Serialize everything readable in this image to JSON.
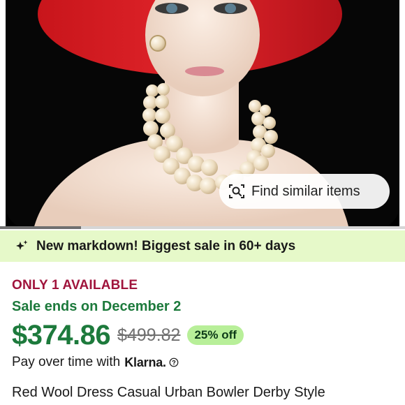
{
  "image": {
    "description_icon": "product-photo",
    "find_similar_label": "Find similar items",
    "find_similar_icon": "visual-search-icon"
  },
  "banner": {
    "icon": "sparkle-icon",
    "text": "New markdown! Biggest sale in 60+ days",
    "background": "#e6f9c9"
  },
  "listing": {
    "availability": "ONLY 1 AVAILABLE",
    "sale_ends": "Sale ends on December 2",
    "price": "$374.86",
    "original_price": "$499.82",
    "discount": "25% off",
    "pay_over_time": "Pay over time with",
    "klarna_label": "Klarna.",
    "help_icon": "help-circle-icon",
    "title": "Red Wool Dress Casual Urban Bowler Derby Style"
  },
  "colors": {
    "price_green": "#1d7a3c",
    "availability_red": "#a0143c",
    "discount_badge": "#b8ef99"
  },
  "gallery": {
    "scroll_position": 0.2
  }
}
